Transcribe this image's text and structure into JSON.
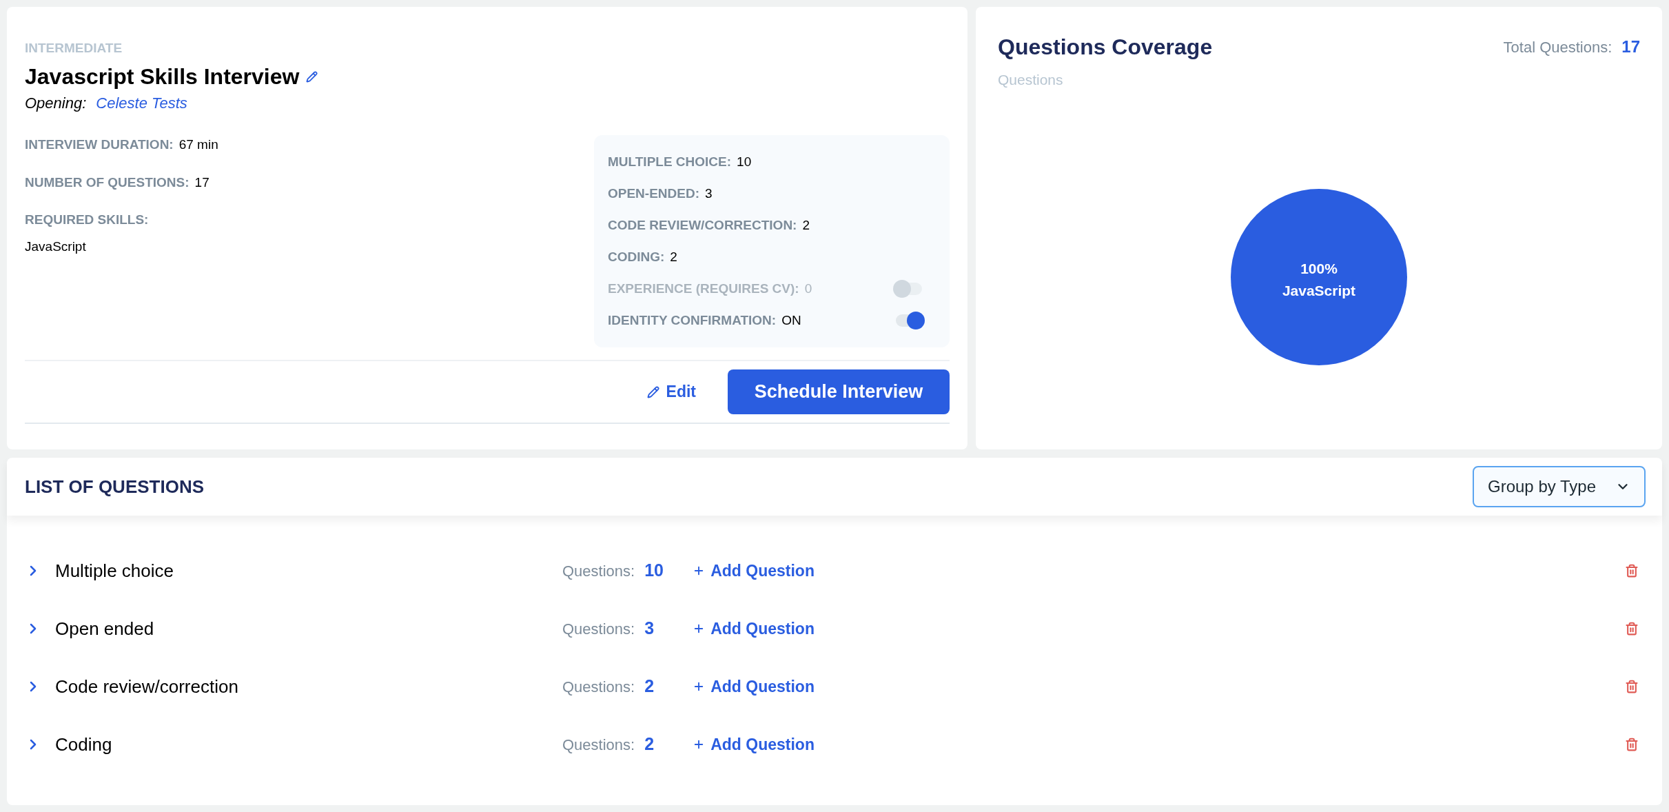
{
  "interview": {
    "level": "INTERMEDIATE",
    "title": "Javascript Skills Interview",
    "opening_label": "Opening:",
    "opening": "Celeste Tests",
    "details": [
      {
        "label": "INTERVIEW DURATION:",
        "value": "67 min"
      },
      {
        "label": "NUMBER OF QUESTIONS:",
        "value": "17"
      },
      {
        "label": "REQUIRED SKILLS:",
        "value": "JavaScript",
        "kind": "block"
      }
    ],
    "breakdown": [
      {
        "kind": "count",
        "label": "MULTIPLE CHOICE:",
        "value": "10",
        "disabled": false
      },
      {
        "kind": "count",
        "label": "OPEN-ENDED:",
        "value": "3",
        "disabled": false
      },
      {
        "kind": "count",
        "label": "CODE REVIEW/CORRECTION:",
        "value": "2",
        "disabled": false
      },
      {
        "kind": "count",
        "label": "CODING:",
        "value": "2",
        "disabled": false
      },
      {
        "kind": "toggle",
        "label": "EXPERIENCE (REQUIRES CV):",
        "value": "0",
        "disabled": true,
        "on": false
      },
      {
        "kind": "toggle",
        "label": "IDENTITY CONFIRMATION:",
        "value": "ON",
        "disabled": false,
        "on": true
      }
    ],
    "edit_button": "Edit",
    "schedule_button": "Schedule Interview"
  },
  "coverage": {
    "title": "Questions Coverage",
    "subtitle": "Questions",
    "total_label": "Total Questions:",
    "total": "17",
    "chart_data": {
      "type": "pie",
      "categories": [
        "JavaScript"
      ],
      "values": [
        100
      ],
      "value_labels": [
        "100%"
      ]
    }
  },
  "questions": {
    "title": "LIST OF QUESTIONS",
    "group_select": "Group by Type",
    "rows": [
      {
        "name": "Multiple choice",
        "count_label": "Questions:",
        "count": "10",
        "add": "Add Question",
        "expanded": false
      },
      {
        "name": "Open ended",
        "count_label": "Questions:",
        "count": "3",
        "add": "Add Question",
        "expanded": false
      },
      {
        "name": "Code review/correction",
        "count_label": "Questions:",
        "count": "2",
        "add": "Add Question",
        "expanded": false
      },
      {
        "name": "Coding",
        "count_label": "Questions:",
        "count": "2",
        "add": "Add Question",
        "expanded": false
      }
    ]
  }
}
